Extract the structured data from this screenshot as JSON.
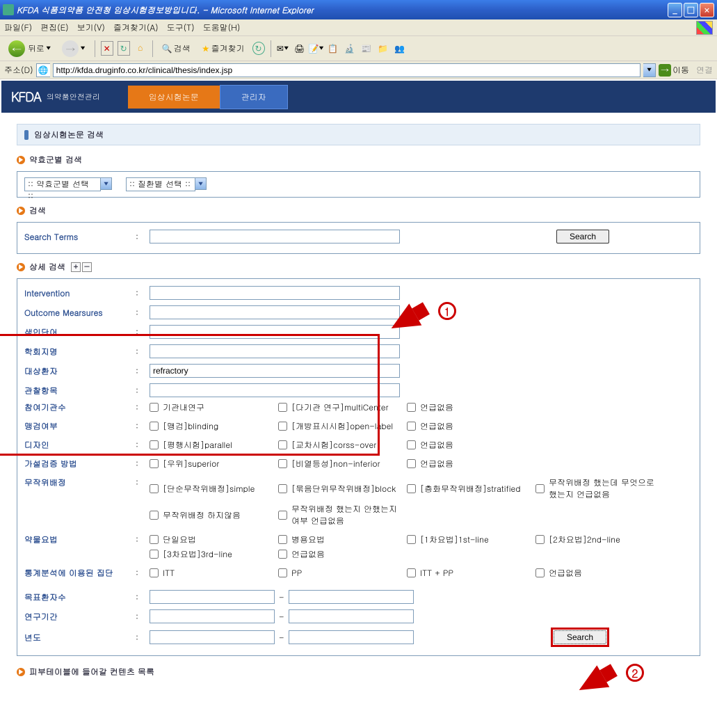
{
  "window": {
    "title": "KFDA 식품의약품 안전청 임상시험정보방입니다. - Microsoft Internet Explorer"
  },
  "menu": {
    "file": "파일(F)",
    "edit": "편집(E)",
    "view": "보기(V)",
    "favorites": "즐겨찾기(A)",
    "tools": "도구(T)",
    "help": "도움말(H)"
  },
  "toolbar": {
    "back": "뒤로",
    "search": "검색",
    "favorites": "즐겨찾기"
  },
  "addr": {
    "label": "주소(D)",
    "url": "http://kfda.druginfo.co.kr/clinical/thesis/index.jsp",
    "go": "이동",
    "links": "연결"
  },
  "kfda": {
    "logo": "KFDA",
    "sub": "의약품안전관리",
    "tab1": "임상시험논문",
    "tab2": "관리자"
  },
  "sections": {
    "main": "임상시험논문 검색",
    "efficacy": "약효군별 검색",
    "search": "검색",
    "detail": "상세 검색",
    "bottom": "피부테이블에 들어갈 컨텐츠 목록"
  },
  "selects": {
    "efficacy": ":: 약효군별 선택 ::",
    "disease": ":: 질환별 선택 ::"
  },
  "labels": {
    "searchTerms": "Search Terms",
    "intervention": "Intervention",
    "outcome": "Outcome Mearsures",
    "keyword": "색인단어",
    "journal": "학회지명",
    "patient": "대상환자",
    "observation": "관찰항목",
    "institutions": "참여기관수",
    "blinding": "맹검여부",
    "design": "디자인",
    "hypothesis": "가설검증 방법",
    "randomization": "무작위배정",
    "drug": "약물요법",
    "stats": "통계분석에 이용된 집단",
    "targetPatients": "목표환자수",
    "period": "연구기간",
    "year": "년도"
  },
  "values": {
    "patient": "refractory"
  },
  "colon": ":",
  "checks": {
    "institutions": {
      "a": "기관내연구",
      "b": "[다기관 연구]multiCenter",
      "c": "언급없음"
    },
    "blinding": {
      "a": "[맹검]blinding",
      "b": "[개방표시시험]open-label",
      "c": "언급없음"
    },
    "design": {
      "a": "[평행시험]parallel",
      "b": "[교차시험]corss-over",
      "c": "언급없음"
    },
    "hypothesis": {
      "a": "[우위]superior",
      "b": "[비열등성]non-inferior",
      "c": "언급없음"
    },
    "randomization": {
      "a": "[단순무작위배정]simple",
      "b": "[묶음단위무작위배정]block",
      "c": "[층화무작위배정]stratified",
      "d": "무작위배정 했는데 무엇으로 했는지 언급없음",
      "e": "무작위배정 하지않음",
      "f": "무작위배정 했는지 안했는지 여부 언급없음"
    },
    "drug": {
      "a": "단일요법",
      "b": "병용요법",
      "c": "[1차요법]1st-line",
      "d": "[2차요법]2nd-line",
      "e": "[3차요법]3rd-line",
      "f": "언급없음"
    },
    "stats": {
      "a": "ITT",
      "b": "PP",
      "c": "ITT + PP",
      "d": "언급없음"
    }
  },
  "buttons": {
    "search": "Search"
  },
  "range": {
    "sep": "-"
  },
  "callouts": {
    "one": "1",
    "two": "2"
  }
}
